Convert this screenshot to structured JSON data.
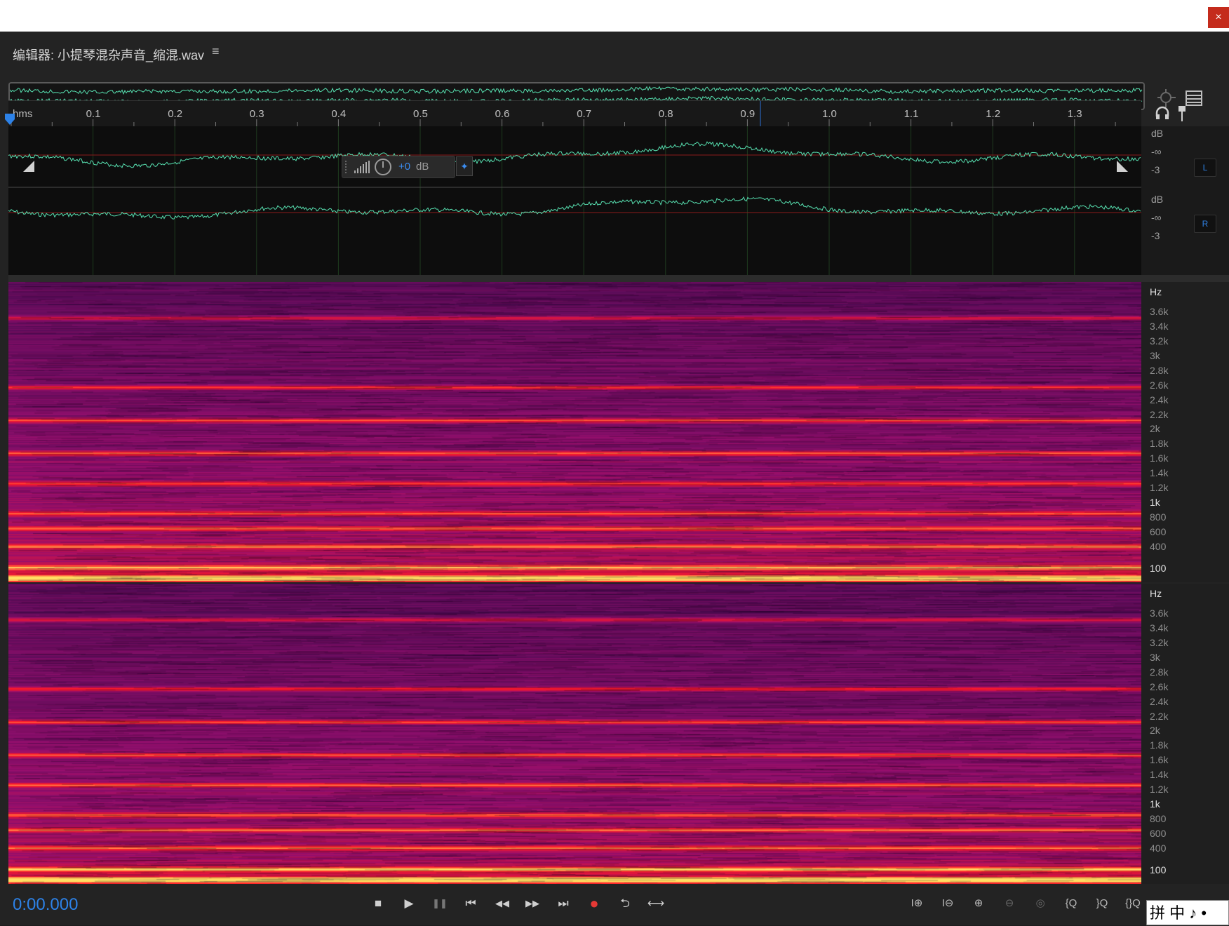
{
  "window": {
    "close_label": "×"
  },
  "editor": {
    "title": "编辑器: 小提琴混杂声音_缩混.wav",
    "menu_icon": "≡"
  },
  "ruler": {
    "unit": "hms",
    "ticks": [
      "0.1",
      "0.2",
      "0.3",
      "0.4",
      "0.5",
      "0.6",
      "0.7",
      "0.8",
      "0.9",
      "1.0",
      "1.1",
      "1.2",
      "1.3"
    ]
  },
  "hud": {
    "value": "+0",
    "unit": "dB"
  },
  "channels": {
    "left": {
      "label": "L",
      "db_labels": [
        "dB",
        "-∞",
        "-3"
      ]
    },
    "right": {
      "label": "R",
      "db_labels": [
        "dB",
        "-∞",
        "-3"
      ]
    }
  },
  "spectral_axis": {
    "unit": "Hz",
    "labels": [
      "3.6k",
      "3.4k",
      "3.2k",
      "3k",
      "2.8k",
      "2.6k",
      "2.4k",
      "2.2k",
      "2k",
      "1.8k",
      "1.6k",
      "1.4k",
      "1.2k",
      "1k",
      "800",
      "600",
      "400",
      "100"
    ]
  },
  "transport": {
    "timecode": "0:00.000",
    "buttons": {
      "stop": "■",
      "play": "▶",
      "pause": "❚❚",
      "to_start": "⏮",
      "rewind": "◀◀",
      "forward": "▶▶",
      "to_end": "⏭",
      "record": "●",
      "loop": "⮌",
      "skip": "⟷"
    }
  },
  "zoom_controls": [
    "I⊕",
    "I⊖",
    "⊕",
    "⊖",
    "◎",
    "{Q",
    "}Q",
    "{}Q"
  ],
  "ime_bar": {
    "text": "拼 中 ♪ •"
  },
  "colors": {
    "accent": "#2d82e8",
    "waveform": "#57e0b0",
    "record": "#e53935"
  }
}
